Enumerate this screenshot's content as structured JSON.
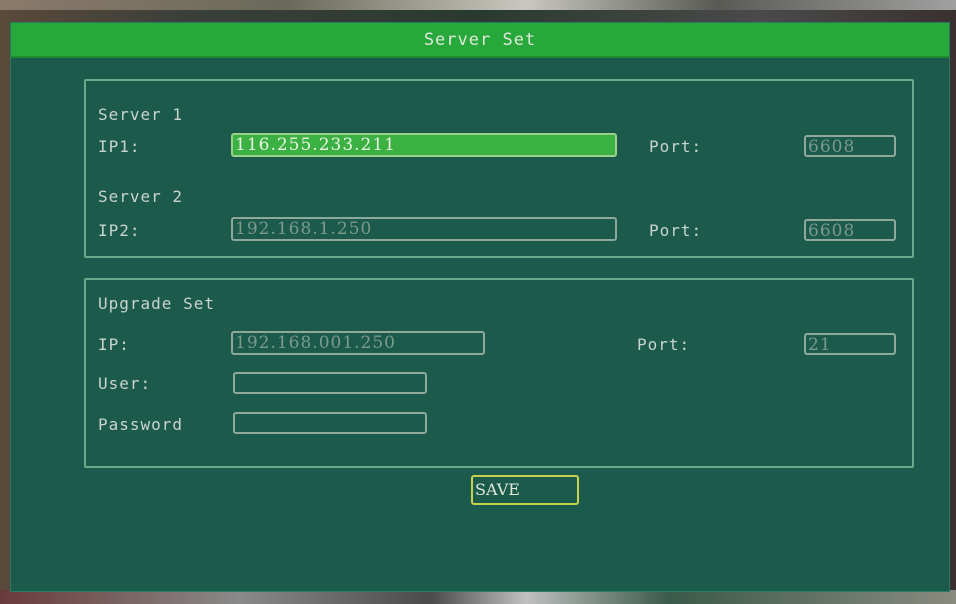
{
  "window": {
    "title": "Server Set"
  },
  "server1": {
    "heading": "Server 1",
    "ip_label": "IP1:",
    "ip_value": "116.255.233.211",
    "port_label": "Port:",
    "port_value": "6608"
  },
  "server2": {
    "heading": "Server 2",
    "ip_label": "IP2:",
    "ip_value": "192.168.1.250",
    "port_label": "Port:",
    "port_value": "6608"
  },
  "upgrade": {
    "heading": "Upgrade Set",
    "ip_label": "IP:",
    "ip_value": "192.168.001.250",
    "port_label": "Port:",
    "port_value": "21",
    "user_label": "User:",
    "user_value": "",
    "password_label": "Password",
    "password_value": ""
  },
  "save_label": "SAVE",
  "colors": {
    "titlebar": "#27a83a",
    "panel": "#1c5a4c",
    "active_field": "#3bb043",
    "button_border": "#c8d050"
  }
}
